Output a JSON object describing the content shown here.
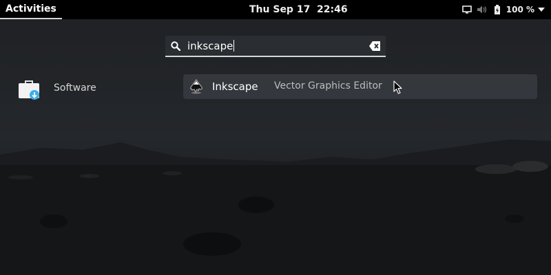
{
  "topbar": {
    "activities_label": "Activities",
    "clock": "Thu Sep 17  22:46",
    "battery_percent": "100 %",
    "icons": [
      "display-icon",
      "volume-muted-icon",
      "battery-icon",
      "menu-arrow-down-icon"
    ]
  },
  "search": {
    "query": "inkscape",
    "icons": [
      "search-icon",
      "clear-text-icon"
    ]
  },
  "provider": {
    "label": "Software",
    "icon": "software-bag-icon"
  },
  "result": {
    "app_name": "Inkscape",
    "description": "Vector Graphics Editor",
    "icon": "inkscape-logo-icon"
  },
  "colors": {
    "topbar_bg": "#000000",
    "overview_bg": "#1c1e21",
    "result_row_bg": "#3a3d42",
    "accent_underline": "#d8d8d8",
    "software_badge": "#3daee9"
  }
}
